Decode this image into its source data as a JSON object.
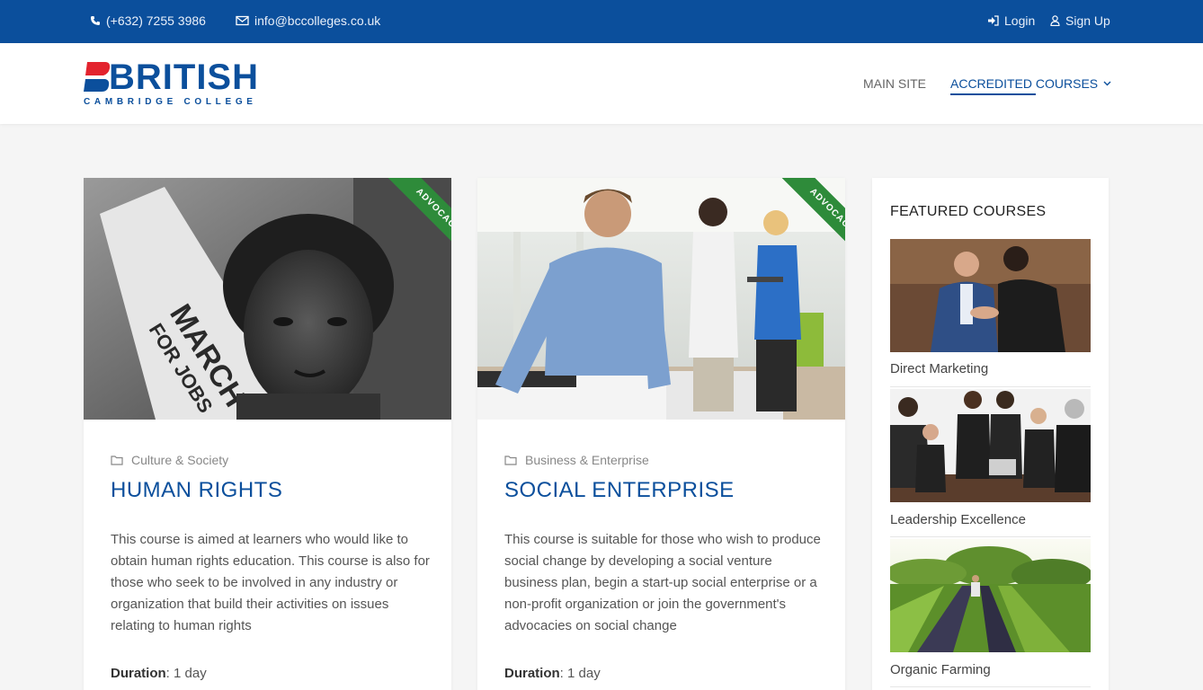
{
  "topbar": {
    "phone": "(+632) 7255 3986",
    "email": "info@bccolleges.co.uk",
    "login": "Login",
    "signup": "Sign Up"
  },
  "logo": {
    "word": "BRITISH",
    "sub": "CAMBRIDGE COLLEGE"
  },
  "nav": {
    "main_site": "MAIN SITE",
    "accredited": "ACCREDITED COURSES"
  },
  "courses": [
    {
      "ribbon": "ADVOCACY",
      "category": "Culture & Society",
      "title": "HUMAN RIGHTS",
      "description": "This course is aimed at learners who would like to obtain human rights education. This course is also for those who seek to be involved in any industry or organization that build their activities on issues relating to human rights",
      "duration_label": "Duration",
      "duration_value": ": 1 day",
      "image_icon": "protest-photo"
    },
    {
      "ribbon": "ADVOCACY",
      "category": "Business & Enterprise",
      "title": "SOCIAL ENTERPRISE",
      "description": "This course is suitable for those who wish to produce social change by developing a social venture business plan, begin a start-up social enterprise or a non-profit organization or join the government's advocacies on social change",
      "duration_label": "Duration",
      "duration_value": ": 1 day",
      "image_icon": "office-team-photo"
    }
  ],
  "sidebar": {
    "title": "FEATURED COURSES",
    "items": [
      {
        "name": "Direct Marketing",
        "image_icon": "handshake-photo"
      },
      {
        "name": "Leadership Excellence",
        "image_icon": "business-meeting-photo"
      },
      {
        "name": "Organic Farming",
        "image_icon": "farm-field-photo"
      }
    ]
  },
  "colors": {
    "brand": "#0b4f9c",
    "ribbon": "#2e8b3a",
    "logo_red": "#e3232e"
  }
}
